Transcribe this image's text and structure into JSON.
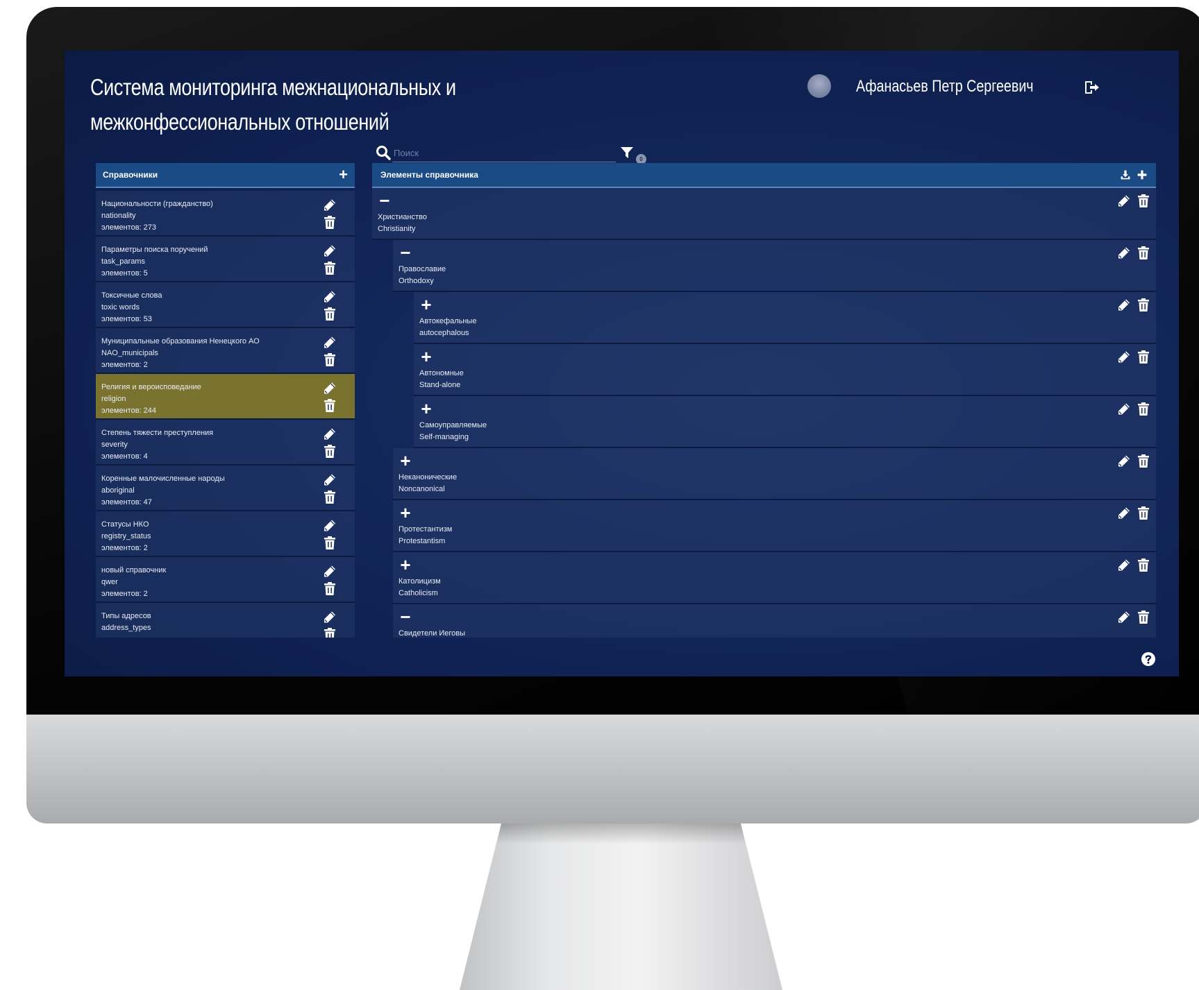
{
  "app": {
    "title_line1": "Система мониторинга межнациональных и",
    "title_line2": "межконфессиональных отношений"
  },
  "user": {
    "name": "Афанасьев Петр Сергеевич"
  },
  "search": {
    "placeholder": "Поиск",
    "filter_count": "0"
  },
  "left_panel": {
    "title": "Справочники",
    "add_label": "+",
    "items": [
      {
        "name": "Национальности (гражданство)",
        "code": "nationality",
        "count": "элементов: 273",
        "selected": false
      },
      {
        "name": "Параметры поиска поручений",
        "code": "task_params",
        "count": "элементов: 5",
        "selected": false
      },
      {
        "name": "Токсичные слова",
        "code": "toxic words",
        "count": "элементов: 53",
        "selected": false
      },
      {
        "name": "Муниципальные образования Ненецкого АО",
        "code": "NAO_municipals",
        "count": "элементов: 2",
        "selected": false
      },
      {
        "name": "Религия и вероисповедание",
        "code": "religion",
        "count": "элементов: 244",
        "selected": true
      },
      {
        "name": "Степень тяжести преступления",
        "code": "severity",
        "count": "элементов: 4",
        "selected": false
      },
      {
        "name": "Коренные малочисленные народы",
        "code": "aboriginal",
        "count": "элементов: 47",
        "selected": false
      },
      {
        "name": "Статусы НКО",
        "code": "registry_status",
        "count": "элементов: 2",
        "selected": false
      },
      {
        "name": "новый справочник",
        "code": "qwer",
        "count": "элементов: 2",
        "selected": false
      },
      {
        "name": "Типы адресов",
        "code": "address_types",
        "count": "",
        "selected": false
      }
    ]
  },
  "right_panel": {
    "title": "Элементы справочника",
    "nodes": [
      {
        "ru": "Христианство",
        "en": "Christianity",
        "expanded": true,
        "level": 0
      },
      {
        "ru": "Православие",
        "en": "Orthodoxy",
        "expanded": true,
        "level": 1
      },
      {
        "ru": "Автокефальные",
        "en": "autocephalous",
        "expanded": false,
        "level": 2
      },
      {
        "ru": "Автономные",
        "en": "Stand-alone",
        "expanded": false,
        "level": 2
      },
      {
        "ru": "Самоуправляемые",
        "en": "Self-managing",
        "expanded": false,
        "level": 2
      },
      {
        "ru": "Неканонические",
        "en": "Noncanonical",
        "expanded": false,
        "level": 1
      },
      {
        "ru": "Протестантизм",
        "en": "Protestantism",
        "expanded": false,
        "level": 1
      },
      {
        "ru": "Католицизм",
        "en": "Catholicism",
        "expanded": false,
        "level": 1
      },
      {
        "ru": "Свидетели Иеговы",
        "en": "",
        "expanded": true,
        "level": 1
      }
    ]
  },
  "icons": {
    "edit": "pencil-icon",
    "delete": "trash-icon",
    "logout": "logout-icon",
    "search": "search-icon",
    "filter": "filter-icon",
    "import": "import-icon",
    "add": "plus-icon",
    "help": "help-icon"
  },
  "colors": {
    "screen_bg": "#122558",
    "header_bar": "#1b4b84",
    "row_bg": "#243a69",
    "selected_row": "#7a7330",
    "text": "#ffffff"
  }
}
